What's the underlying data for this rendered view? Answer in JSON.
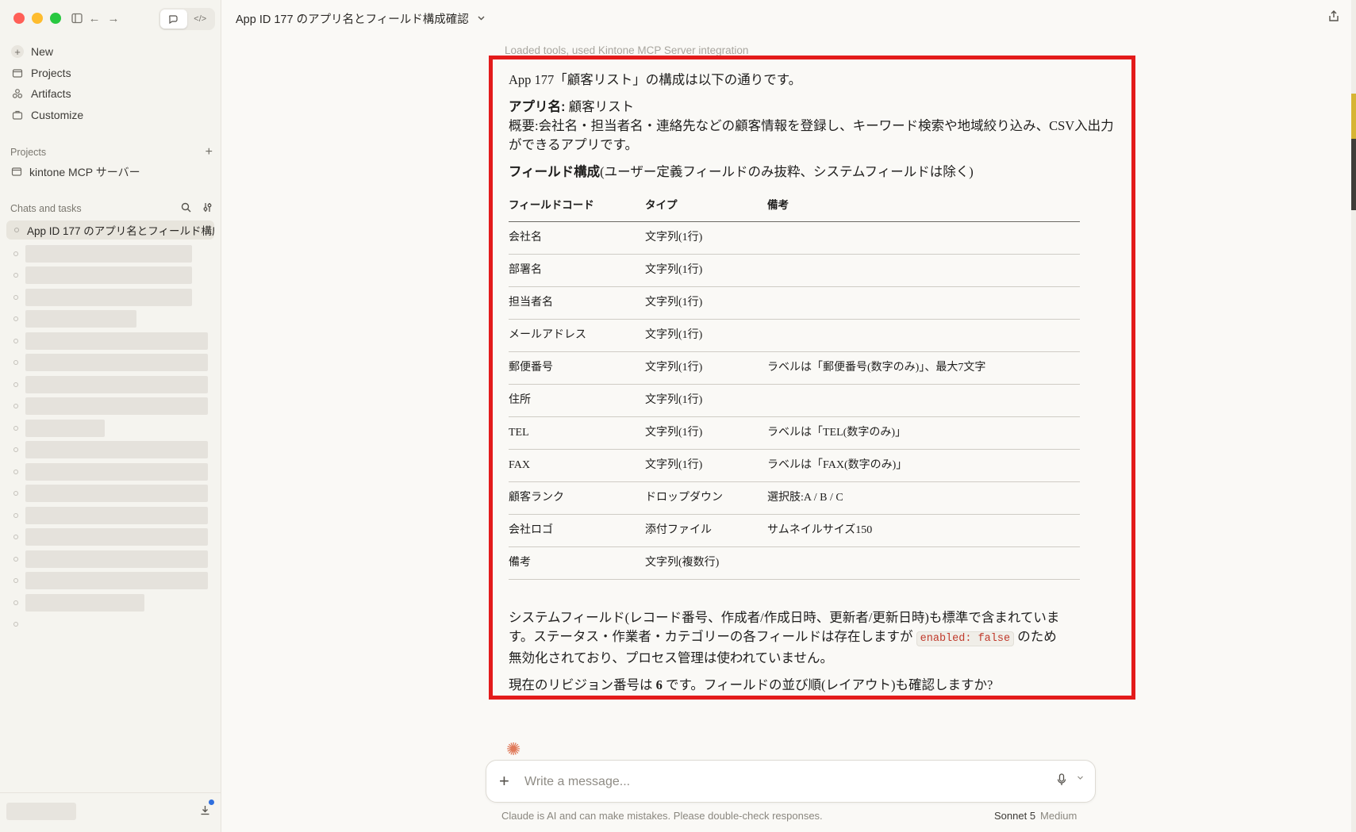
{
  "window": {
    "traffic_colors": [
      "#ff5f57",
      "#febc2e",
      "#28c840"
    ]
  },
  "sidebar": {
    "nav": [
      {
        "label": "New",
        "icon": "plus-icon"
      },
      {
        "label": "Projects",
        "icon": "folder-icon"
      },
      {
        "label": "Artifacts",
        "icon": "artifacts-icon"
      },
      {
        "label": "Customize",
        "icon": "briefcase-icon"
      }
    ],
    "projects_heading": "Projects",
    "project_item": "kintone MCP サーバー",
    "chats_heading": "Chats and tasks",
    "active_chat": "App ID 177 のアプリ名とフィールド構成確認"
  },
  "header": {
    "title": "App ID 177 のアプリ名とフィールド構成確認"
  },
  "conversation": {
    "tools_line": "Loaded tools, used Kintone MCP Server integration",
    "intro": "App 177「顧客リスト」の構成は以下の通りです。",
    "app_name_label": "アプリ名:",
    "app_name_value": " 顧客リスト",
    "summary": "概要:会社名・担当者名・連絡先などの顧客情報を登録し、キーワード検索や地域絞り込み、CSV入出力ができるアプリです。",
    "fields_heading_bold": "フィールド構成",
    "fields_heading_rest": "(ユーザー定義フィールドのみ抜粋、システムフィールドは除く)",
    "table": {
      "headers": [
        "フィールドコード",
        "タイプ",
        "備考"
      ],
      "rows": [
        [
          "会社名",
          "文字列(1行)",
          ""
        ],
        [
          "部署名",
          "文字列(1行)",
          ""
        ],
        [
          "担当者名",
          "文字列(1行)",
          ""
        ],
        [
          "メールアドレス",
          "文字列(1行)",
          ""
        ],
        [
          "郵便番号",
          "文字列(1行)",
          "ラベルは「郵便番号(数字のみ)」、最大7文字"
        ],
        [
          "住所",
          "文字列(1行)",
          ""
        ],
        [
          "TEL",
          "文字列(1行)",
          "ラベルは「TEL(数字のみ)」"
        ],
        [
          "FAX",
          "文字列(1行)",
          "ラベルは「FAX(数字のみ)」"
        ],
        [
          "顧客ランク",
          "ドロップダウン",
          "選択肢:A / B / C"
        ],
        [
          "会社ロゴ",
          "添付ファイル",
          "サムネイルサイズ150"
        ],
        [
          "備考",
          "文字列(複数行)",
          ""
        ]
      ]
    },
    "system_text_1": "システムフィールド(レコード番号、作成者/作成日時、更新者/更新日時)も標準で含まれています。ステータス・作業者・カテゴリーの各フィールドは存在しますが",
    "system_code": "enabled: false",
    "system_text_2": "のため無効化されており、プロセス管理は使われていません。",
    "revision_text_1": "現在のリビジョン番号は",
    "revision_number": "6",
    "revision_text_2": "です。フィールドの並び順(レイアウト)も確認しますか?"
  },
  "composer": {
    "placeholder": "Write a message..."
  },
  "footer": {
    "disclaimer": "Claude is AI and can make mistakes. Please double-check responses.",
    "model": "Sonnet 5",
    "effort": "Medium"
  }
}
